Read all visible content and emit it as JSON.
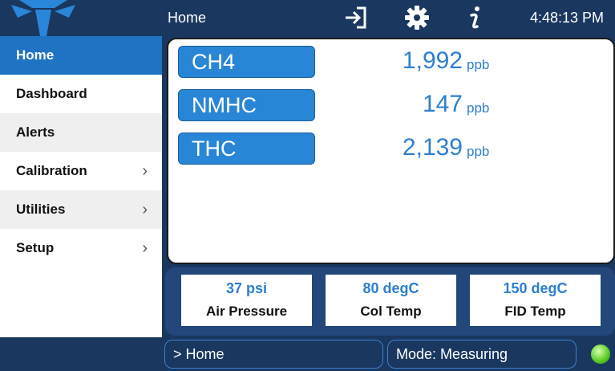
{
  "header": {
    "title": "Home",
    "clock": "4:48:13 PM"
  },
  "icons": {
    "logo": "company-logo",
    "signin": "sign-in-icon",
    "settings": "gear-icon",
    "info": "info-icon"
  },
  "sidebar": {
    "items": [
      {
        "label": "Home",
        "has_submenu": false,
        "active": true
      },
      {
        "label": "Dashboard",
        "has_submenu": false,
        "active": false
      },
      {
        "label": "Alerts",
        "has_submenu": false,
        "active": false
      },
      {
        "label": "Calibration",
        "has_submenu": true,
        "active": false
      },
      {
        "label": "Utilities",
        "has_submenu": true,
        "active": false
      },
      {
        "label": "Setup",
        "has_submenu": true,
        "active": false
      }
    ],
    "chevron": "›"
  },
  "measurements": [
    {
      "name": "CH4",
      "value": "1,992",
      "unit": "ppb"
    },
    {
      "name": "NMHC",
      "value": "147",
      "unit": "ppb"
    },
    {
      "name": "THC",
      "value": "2,139",
      "unit": "ppb"
    }
  ],
  "status": [
    {
      "value": "37 psi",
      "label": "Air Pressure"
    },
    {
      "value": "80 degC",
      "label": "Col Temp"
    },
    {
      "value": "150 degC",
      "label": "FID Temp"
    }
  ],
  "footer": {
    "breadcrumb": "> Home",
    "mode": "Mode: Measuring",
    "led_color": "#5fcf2b"
  },
  "colors": {
    "accent": "#1f73c2",
    "value": "#2d7fcf",
    "background": "#1a3760"
  }
}
